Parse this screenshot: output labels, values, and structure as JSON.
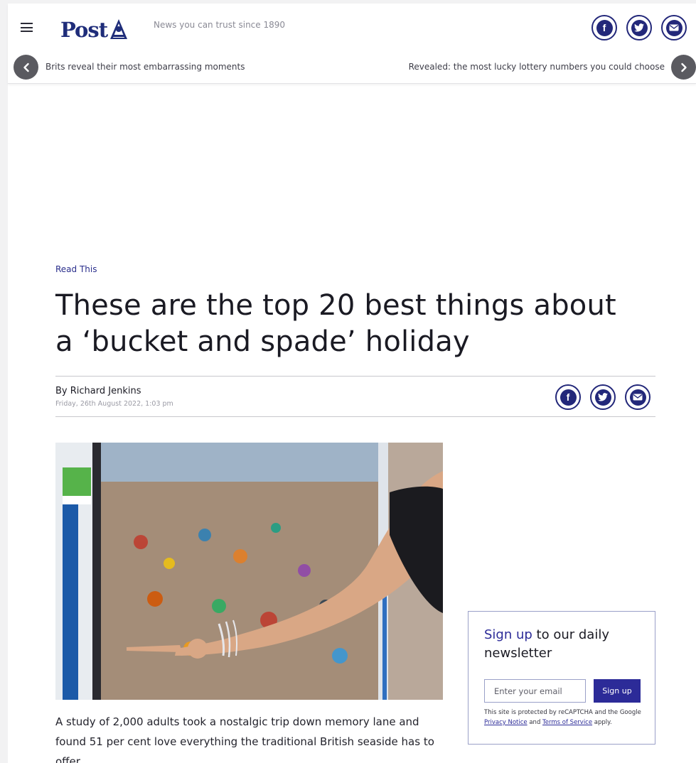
{
  "header": {
    "logo_text": "Post",
    "tagline": "News you can trust since 1890",
    "social": {
      "facebook": "f",
      "twitter": "twitter-bird",
      "email": "envelope"
    }
  },
  "ticker": {
    "left_headline": "Brits reveal their most embarrassing moments",
    "right_headline": "Revealed: the most lucky lottery numbers you could choose"
  },
  "article": {
    "kicker": "Read This",
    "headline": "These are the top 20 best things about a ‘bucket and spade’ holiday",
    "author": "By Richard Jenkins",
    "date": "Friday, 26th August 2022, 1:03 pm",
    "body_intro": "A study of 2,000 adults took a nostalgic trip down memory lane and found 51 per cent love everything the traditional British seaside has to offer."
  },
  "newsletter": {
    "title_accent": "Sign up",
    "title_rest": " to our daily newsletter",
    "email_placeholder": "Enter your email",
    "button_label": "Sign up",
    "legal_prefix": "This site is protected by reCAPTCHA and the Google ",
    "privacy_link": "Privacy Notice",
    "legal_and": " and ",
    "terms_link": "Terms of Service",
    "legal_suffix": " apply."
  },
  "colors": {
    "brand": "#23287a",
    "accent": "#2c2b98",
    "arrow_bg": "#5a5a60"
  }
}
